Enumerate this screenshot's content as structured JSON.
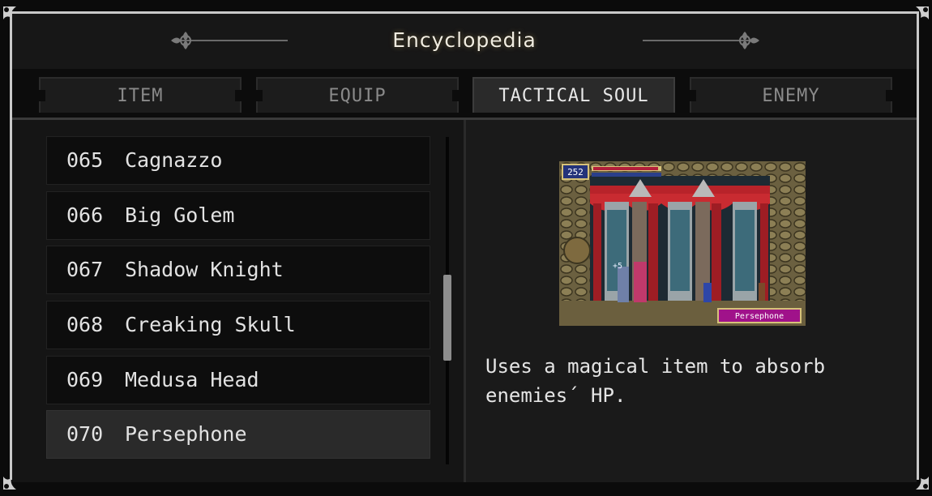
{
  "title": "Encyclopedia",
  "tabs": [
    {
      "label": "ITEM",
      "active": false
    },
    {
      "label": "EQUIP",
      "active": false
    },
    {
      "label": "TACTICAL SOUL",
      "active": true
    },
    {
      "label": "ENEMY",
      "active": false
    }
  ],
  "entries": [
    {
      "number": "065",
      "name": "Cagnazzo",
      "selected": false
    },
    {
      "number": "066",
      "name": "Big Golem",
      "selected": false
    },
    {
      "number": "067",
      "name": "Shadow Knight",
      "selected": false
    },
    {
      "number": "068",
      "name": "Creaking Skull",
      "selected": false
    },
    {
      "number": "069",
      "name": "Medusa Head",
      "selected": false
    },
    {
      "number": "070",
      "name": "Persephone",
      "selected": true
    }
  ],
  "scrollbar": {
    "position_fraction": 0.55
  },
  "preview": {
    "hud_value": "252",
    "caption": "Persephone",
    "floating_number": "+5"
  },
  "description": [
    "Uses a magical item to absorb",
    "enemies´ HP."
  ],
  "colors": {
    "frame": "#c9c9c9",
    "curtain": "#b8232a",
    "caption_bg": "#a0128a",
    "stone": "#5b5131"
  }
}
